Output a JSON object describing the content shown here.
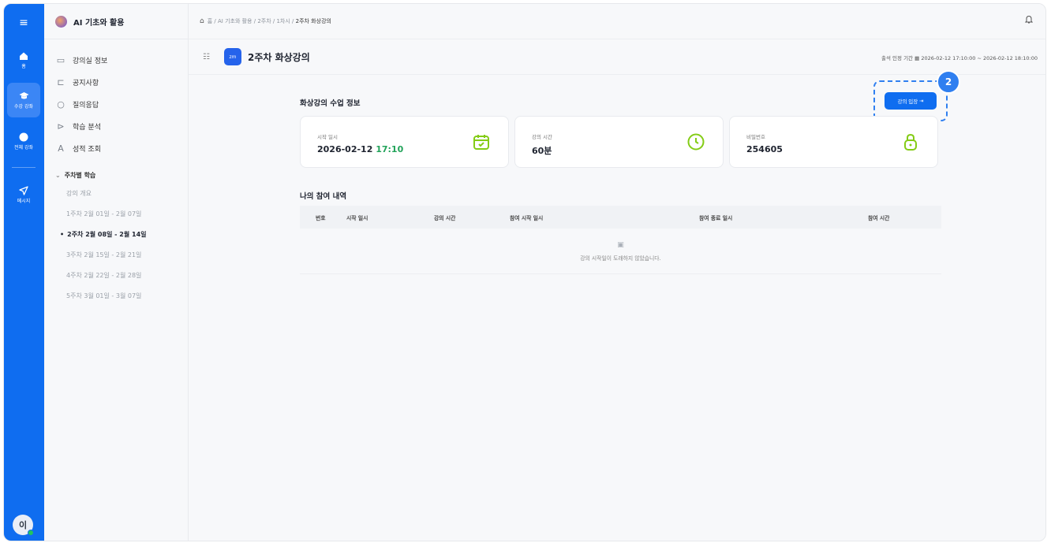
{
  "rail": {
    "items": [
      {
        "label": "홈",
        "icon": "home-icon"
      },
      {
        "label": "수강 강좌",
        "icon": "graduation-cap-icon"
      },
      {
        "label": "전체 강좌",
        "icon": "compass-icon"
      },
      {
        "label": "메시지",
        "icon": "send-icon"
      }
    ],
    "avatar": "이"
  },
  "sidebar": {
    "course_title": "AI 기초와 활용",
    "nav": [
      {
        "label": "강의실 정보"
      },
      {
        "label": "공지사항"
      },
      {
        "label": "질의응답"
      },
      {
        "label": "학습 분석"
      },
      {
        "label": "성적 조회"
      }
    ],
    "weekly_heading": "주차별 학습",
    "weeks": [
      {
        "label": "강의 개요"
      },
      {
        "label": "1주차 2월 01일 - 2월 07일"
      },
      {
        "label": "2주차 2월 08일 - 2월 14일"
      },
      {
        "label": "3주차 2월 15일 - 2월 21일"
      },
      {
        "label": "4주차 2월 22일 - 2월 28일"
      },
      {
        "label": "5주차 3월 01일 - 3월 07일"
      }
    ]
  },
  "breadcrumb": {
    "items": [
      "홈",
      "AI 기초와 활용",
      "2주차",
      "1차시",
      "2주차 화상강의"
    ]
  },
  "page": {
    "badge": "zm",
    "title": "2주차 화상강의",
    "period_label": "출석 인정 기간",
    "period_value": "2026-02-12 17:10:00 ~ 2026-02-12 18:10:00"
  },
  "info": {
    "title": "화상강의 수업 정보",
    "enter_button": "강의 입장",
    "step_badge": "2",
    "cards": [
      {
        "label": "시작 일시",
        "date": "2026-02-12",
        "time": "17:10"
      },
      {
        "label": "강의 시간",
        "value": "60분"
      },
      {
        "label": "비밀번호",
        "value": "254605"
      }
    ]
  },
  "history": {
    "title": "나의 참여 내역",
    "columns": [
      "번호",
      "시작 일시",
      "강의 시간",
      "참여 시작 일시",
      "참여 종료 일시",
      "참여 시간"
    ],
    "empty_message": "강의 시작일이 도래하지 않았습니다."
  },
  "colors": {
    "brand": "#0f6df0",
    "accent_green": "#84cc16",
    "time_green": "#22a35a"
  }
}
